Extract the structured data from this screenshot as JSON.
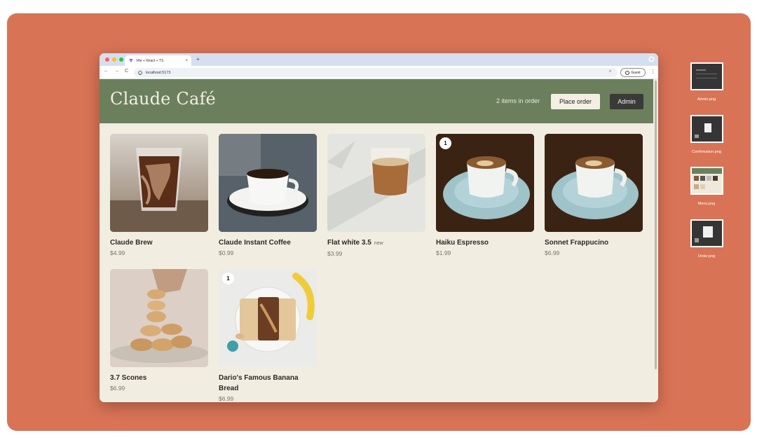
{
  "browser": {
    "tab_title": "Vite + React + TS",
    "tab_close": "×",
    "new_tab": "+",
    "url": "localhost:5173",
    "guest_label": "Guest",
    "tab_menu": "⌄",
    "nav": {
      "back": "←",
      "forward": "→",
      "reload": "C"
    },
    "zoom_icon": "⌕",
    "kebab": "⋮"
  },
  "header": {
    "brand": "Claude Café",
    "items_in_order": "2 items in order",
    "place_order_label": "Place order",
    "admin_label": "Admin"
  },
  "menu": {
    "items": [
      {
        "name": "Claude Brew",
        "price": "$4.99",
        "badge": "",
        "tag": ""
      },
      {
        "name": "Claude Instant Coffee",
        "price": "$0.99",
        "badge": "",
        "tag": ""
      },
      {
        "name": "Flat white 3.5",
        "price": "$3.99",
        "badge": "",
        "tag": "new"
      },
      {
        "name": "Haiku Espresso",
        "price": "$1.99",
        "badge": "1",
        "tag": ""
      },
      {
        "name": "Sonnet Frappucino",
        "price": "$6.99",
        "badge": "",
        "tag": ""
      },
      {
        "name": "3.7 Scones",
        "price": "$6.99",
        "badge": "",
        "tag": ""
      },
      {
        "name": "Dario's Famous Banana Bread",
        "price": "$6.99",
        "badge": "1",
        "tag": ""
      }
    ]
  },
  "desktop_files": [
    {
      "name": "Admin.png"
    },
    {
      "name": "Confirmation.png"
    },
    {
      "name": "Menu.png"
    },
    {
      "name": "Order.png"
    }
  ],
  "colors": {
    "desktop_bg": "#d97356",
    "header_green": "#6b7f5c",
    "page_bg": "#f2ede1",
    "admin_button": "#3a3a38"
  }
}
